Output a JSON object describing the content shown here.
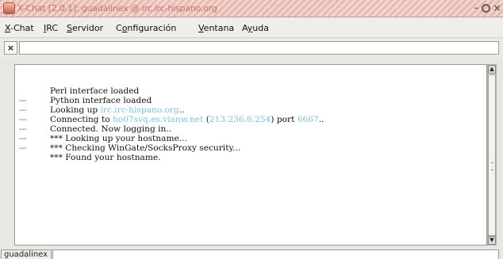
{
  "window": {
    "title": "X-Chat [2.0.1]: guadalinex @ irc.irc-hispano.org",
    "buttons": {
      "minimize": "–",
      "maximize": "",
      "close": "×"
    }
  },
  "menu": {
    "items": [
      {
        "accel": "X",
        "rest": "-Chat"
      },
      {
        "accel": "I",
        "rest": "RC"
      },
      {
        "accel": "S",
        "rest": "ervidor"
      },
      {
        "accel": "",
        "pre": "C",
        "accel2": "o",
        "rest": "nfiguración"
      },
      {
        "accel": "V",
        "rest": "entana"
      },
      {
        "accel": "",
        "pre": "A",
        "accel2": "y",
        "rest": "uda"
      }
    ]
  },
  "toolbar": {
    "close_label": "×",
    "topic": ""
  },
  "log": {
    "lines": [
      {
        "prefix": "",
        "parts": [
          "Perl interface loaded"
        ]
      },
      {
        "prefix": "",
        "parts": [
          "Python interface loaded"
        ]
      },
      {
        "prefix": "---",
        "parts": [
          "Looking up ",
          "irc.irc-hispano.org",
          ".."
        ]
      },
      {
        "prefix": "---",
        "parts": [
          "Connecting to ",
          "ho07svq.es.vianw.net",
          " (",
          "213.236.6.254",
          ") port ",
          "6667",
          ".."
        ]
      },
      {
        "prefix": "---",
        "parts": [
          "Connected. Now logging in.."
        ]
      },
      {
        "prefix": "---",
        "parts": [
          "*** Looking up your hostname..."
        ]
      },
      {
        "prefix": "---",
        "parts": [
          "*** Checking WinGate/SocksProxy security..."
        ]
      },
      {
        "prefix": "---",
        "parts": [
          "*** Found your hostname."
        ]
      }
    ]
  },
  "scrollbar": {
    "up": "▲",
    "down": "▼"
  },
  "input": {
    "nick": "guadalinex",
    "value": ""
  },
  "colors": {
    "highlight": "#7fc0d8",
    "prefix": "#4f6f8a",
    "title": "#c2776a"
  }
}
